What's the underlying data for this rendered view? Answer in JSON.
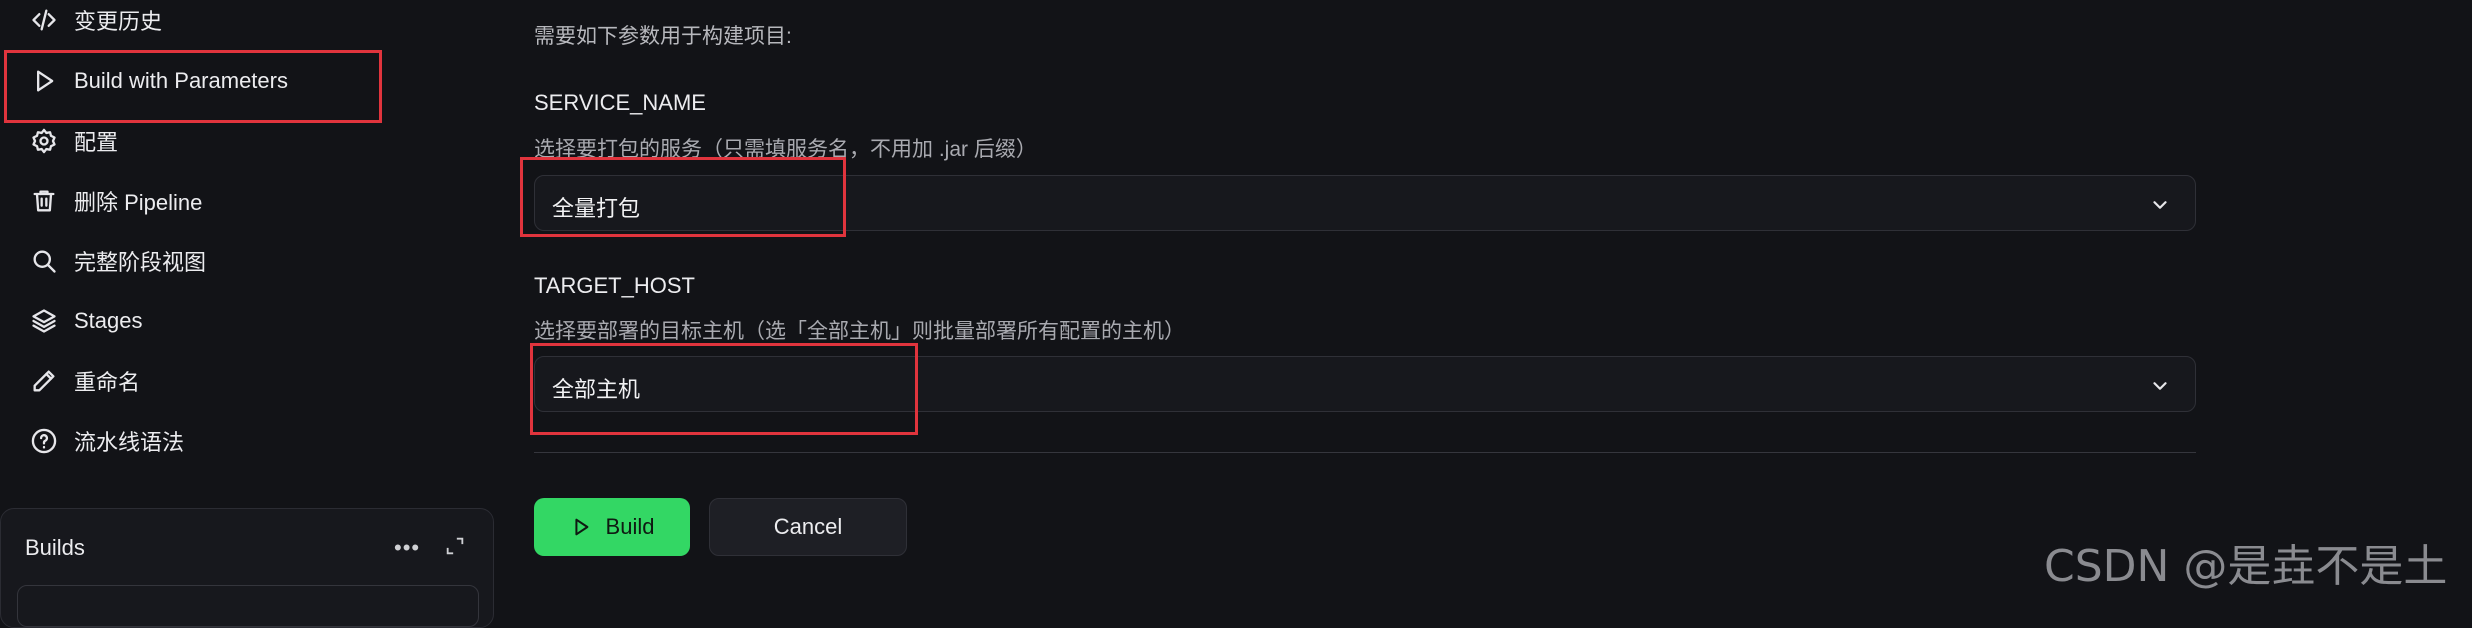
{
  "sidebar": {
    "items": [
      {
        "label": "变更历史",
        "icon": "code-icon"
      },
      {
        "label": "Build with Parameters",
        "icon": "play-icon"
      },
      {
        "label": "配置",
        "icon": "gear-icon"
      },
      {
        "label": "删除 Pipeline",
        "icon": "trash-icon"
      },
      {
        "label": "完整阶段视图",
        "icon": "search-icon"
      },
      {
        "label": "Stages",
        "icon": "layers-icon"
      },
      {
        "label": "重命名",
        "icon": "pencil-icon"
      },
      {
        "label": "流水线语法",
        "icon": "help-circle-icon"
      }
    ]
  },
  "builds": {
    "title": "Builds",
    "more_label": "•••"
  },
  "form": {
    "intro": "需要如下参数用于构建项目:",
    "params": [
      {
        "name": "SERVICE_NAME",
        "description": "选择要打包的服务（只需填服务名，不用加 .jar 后缀）",
        "value": "全量打包"
      },
      {
        "name": "TARGET_HOST",
        "description": "选择要部署的目标主机（选「全部主机」则批量部署所有配置的主机）",
        "value": "全部主机"
      }
    ],
    "build_label": "Build",
    "cancel_label": "Cancel"
  },
  "watermark": "CSDN @是垚不是土",
  "colors": {
    "background": "#121317",
    "highlight": "#e0343d",
    "build_button": "#33d764"
  }
}
